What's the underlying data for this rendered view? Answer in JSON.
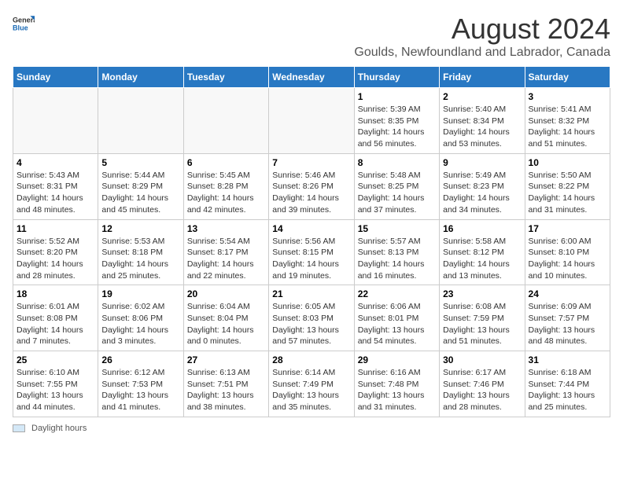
{
  "header": {
    "logo_general": "General",
    "logo_blue": "Blue",
    "title": "August 2024",
    "subtitle": "Goulds, Newfoundland and Labrador, Canada"
  },
  "calendar": {
    "days_of_week": [
      "Sunday",
      "Monday",
      "Tuesday",
      "Wednesday",
      "Thursday",
      "Friday",
      "Saturday"
    ],
    "weeks": [
      [
        {
          "date": "",
          "info": ""
        },
        {
          "date": "",
          "info": ""
        },
        {
          "date": "",
          "info": ""
        },
        {
          "date": "",
          "info": ""
        },
        {
          "date": "1",
          "info": "Sunrise: 5:39 AM\nSunset: 8:35 PM\nDaylight: 14 hours and 56 minutes."
        },
        {
          "date": "2",
          "info": "Sunrise: 5:40 AM\nSunset: 8:34 PM\nDaylight: 14 hours and 53 minutes."
        },
        {
          "date": "3",
          "info": "Sunrise: 5:41 AM\nSunset: 8:32 PM\nDaylight: 14 hours and 51 minutes."
        }
      ],
      [
        {
          "date": "4",
          "info": "Sunrise: 5:43 AM\nSunset: 8:31 PM\nDaylight: 14 hours and 48 minutes."
        },
        {
          "date": "5",
          "info": "Sunrise: 5:44 AM\nSunset: 8:29 PM\nDaylight: 14 hours and 45 minutes."
        },
        {
          "date": "6",
          "info": "Sunrise: 5:45 AM\nSunset: 8:28 PM\nDaylight: 14 hours and 42 minutes."
        },
        {
          "date": "7",
          "info": "Sunrise: 5:46 AM\nSunset: 8:26 PM\nDaylight: 14 hours and 39 minutes."
        },
        {
          "date": "8",
          "info": "Sunrise: 5:48 AM\nSunset: 8:25 PM\nDaylight: 14 hours and 37 minutes."
        },
        {
          "date": "9",
          "info": "Sunrise: 5:49 AM\nSunset: 8:23 PM\nDaylight: 14 hours and 34 minutes."
        },
        {
          "date": "10",
          "info": "Sunrise: 5:50 AM\nSunset: 8:22 PM\nDaylight: 14 hours and 31 minutes."
        }
      ],
      [
        {
          "date": "11",
          "info": "Sunrise: 5:52 AM\nSunset: 8:20 PM\nDaylight: 14 hours and 28 minutes."
        },
        {
          "date": "12",
          "info": "Sunrise: 5:53 AM\nSunset: 8:18 PM\nDaylight: 14 hours and 25 minutes."
        },
        {
          "date": "13",
          "info": "Sunrise: 5:54 AM\nSunset: 8:17 PM\nDaylight: 14 hours and 22 minutes."
        },
        {
          "date": "14",
          "info": "Sunrise: 5:56 AM\nSunset: 8:15 PM\nDaylight: 14 hours and 19 minutes."
        },
        {
          "date": "15",
          "info": "Sunrise: 5:57 AM\nSunset: 8:13 PM\nDaylight: 14 hours and 16 minutes."
        },
        {
          "date": "16",
          "info": "Sunrise: 5:58 AM\nSunset: 8:12 PM\nDaylight: 14 hours and 13 minutes."
        },
        {
          "date": "17",
          "info": "Sunrise: 6:00 AM\nSunset: 8:10 PM\nDaylight: 14 hours and 10 minutes."
        }
      ],
      [
        {
          "date": "18",
          "info": "Sunrise: 6:01 AM\nSunset: 8:08 PM\nDaylight: 14 hours and 7 minutes."
        },
        {
          "date": "19",
          "info": "Sunrise: 6:02 AM\nSunset: 8:06 PM\nDaylight: 14 hours and 3 minutes."
        },
        {
          "date": "20",
          "info": "Sunrise: 6:04 AM\nSunset: 8:04 PM\nDaylight: 14 hours and 0 minutes."
        },
        {
          "date": "21",
          "info": "Sunrise: 6:05 AM\nSunset: 8:03 PM\nDaylight: 13 hours and 57 minutes."
        },
        {
          "date": "22",
          "info": "Sunrise: 6:06 AM\nSunset: 8:01 PM\nDaylight: 13 hours and 54 minutes."
        },
        {
          "date": "23",
          "info": "Sunrise: 6:08 AM\nSunset: 7:59 PM\nDaylight: 13 hours and 51 minutes."
        },
        {
          "date": "24",
          "info": "Sunrise: 6:09 AM\nSunset: 7:57 PM\nDaylight: 13 hours and 48 minutes."
        }
      ],
      [
        {
          "date": "25",
          "info": "Sunrise: 6:10 AM\nSunset: 7:55 PM\nDaylight: 13 hours and 44 minutes."
        },
        {
          "date": "26",
          "info": "Sunrise: 6:12 AM\nSunset: 7:53 PM\nDaylight: 13 hours and 41 minutes."
        },
        {
          "date": "27",
          "info": "Sunrise: 6:13 AM\nSunset: 7:51 PM\nDaylight: 13 hours and 38 minutes."
        },
        {
          "date": "28",
          "info": "Sunrise: 6:14 AM\nSunset: 7:49 PM\nDaylight: 13 hours and 35 minutes."
        },
        {
          "date": "29",
          "info": "Sunrise: 6:16 AM\nSunset: 7:48 PM\nDaylight: 13 hours and 31 minutes."
        },
        {
          "date": "30",
          "info": "Sunrise: 6:17 AM\nSunset: 7:46 PM\nDaylight: 13 hours and 28 minutes."
        },
        {
          "date": "31",
          "info": "Sunrise: 6:18 AM\nSunset: 7:44 PM\nDaylight: 13 hours and 25 minutes."
        }
      ]
    ]
  },
  "footer": {
    "legend_label": "Daylight hours"
  }
}
